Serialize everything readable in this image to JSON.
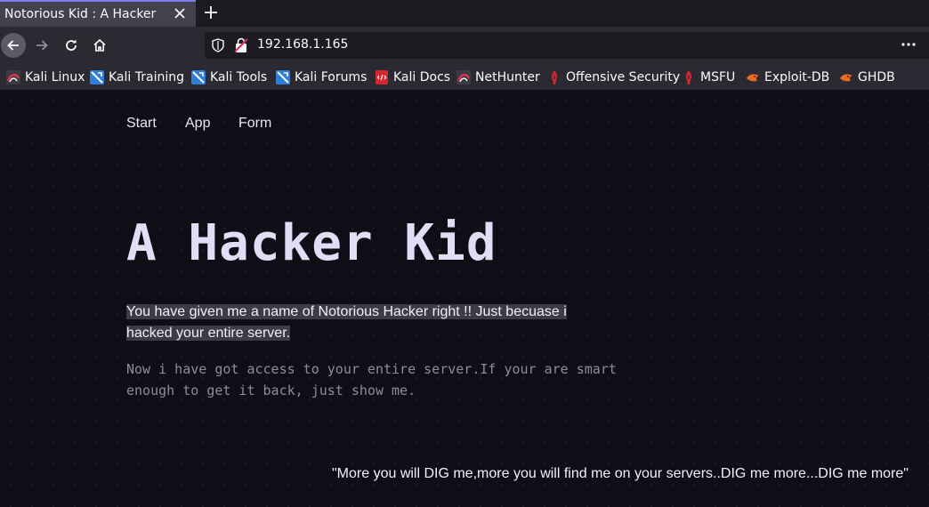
{
  "browser": {
    "tab": {
      "title": "Notorious Kid : A Hacker"
    },
    "url": "192.168.1.165",
    "bookmarks": [
      {
        "label": "Kali Linux",
        "icon": "kali-icon"
      },
      {
        "label": "Kali Training",
        "icon": "kali-training-icon"
      },
      {
        "label": "Kali Tools",
        "icon": "kali-tools-icon"
      },
      {
        "label": "Kali Forums",
        "icon": "kali-forums-icon"
      },
      {
        "label": "Kali Docs",
        "icon": "kali-docs-icon"
      },
      {
        "label": "NetHunter",
        "icon": "nethunter-icon"
      },
      {
        "label": "Offensive Security",
        "icon": "offsec-icon"
      },
      {
        "label": "MSFU",
        "icon": "msfu-icon"
      },
      {
        "label": "Exploit-DB",
        "icon": "exploitdb-icon"
      },
      {
        "label": "GHDB",
        "icon": "ghdb-icon"
      }
    ]
  },
  "page": {
    "nav": {
      "start": "Start",
      "app": "App",
      "form": "Form"
    },
    "headline": "A Hacker Kid",
    "lead": "You have given me a name of Notorious Hacker right !! Just becuase i hacked your entire server.",
    "sub": "Now i have got access to your entire server.If your are smart enough to get it back, just show me.",
    "quote": "\"More you will DIG me,more you will find me on your servers..DIG me more...DIG me more\""
  },
  "colors": {
    "page_bg": "#0f0e17",
    "headline": "#e0ddf5",
    "muted_text": "#8e8c98",
    "highlight_bg": "#3d3c45",
    "tab_accent": "#7c7cf0"
  }
}
